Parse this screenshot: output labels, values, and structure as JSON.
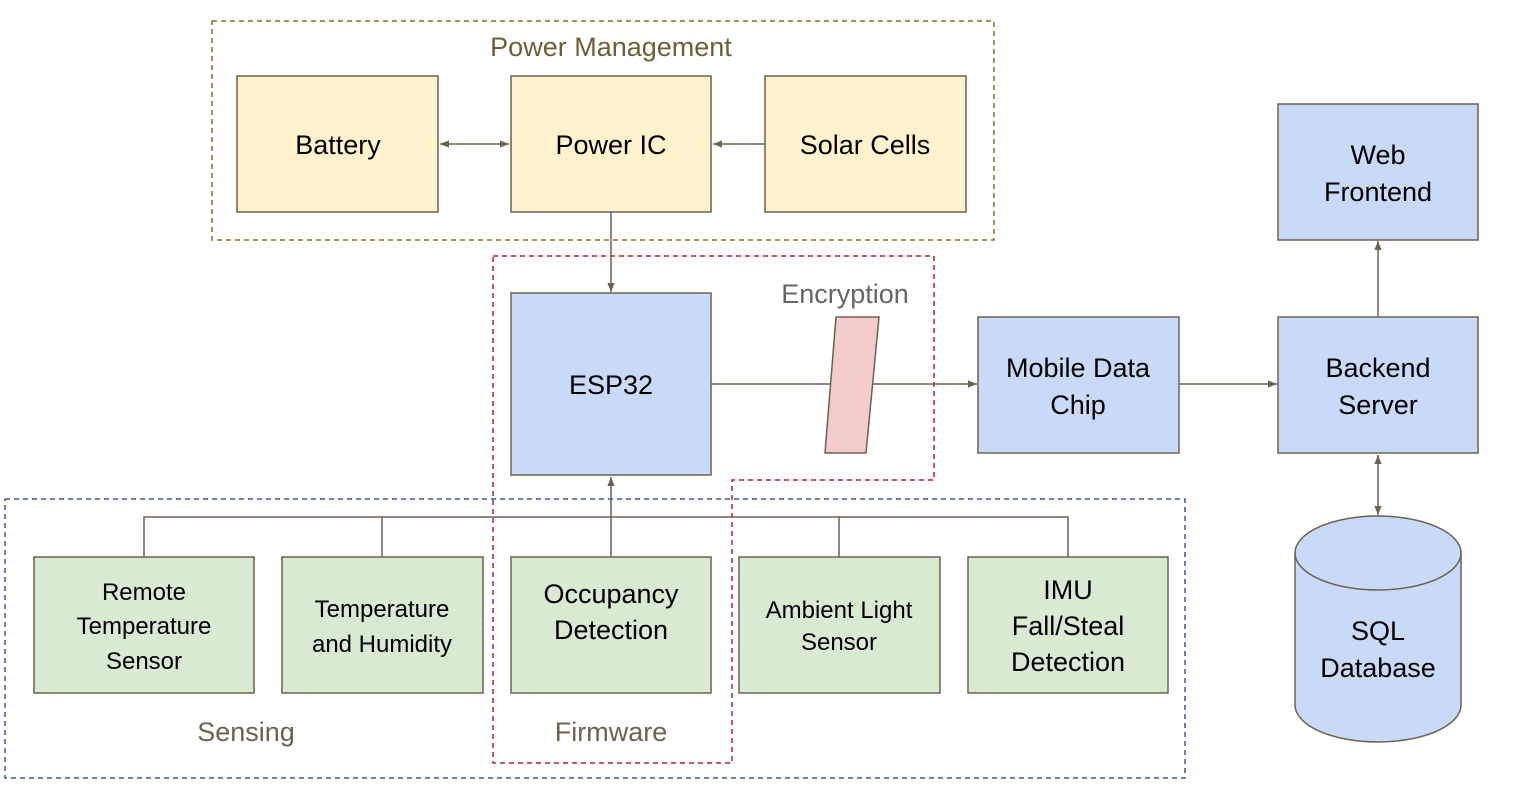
{
  "colors": {
    "power_fill": "#fff2cc",
    "compute_fill": "#c9daf8",
    "sensor_fill": "#d9ead3",
    "encryption_fill": "#f4cccc",
    "stroke": "#6b6250",
    "power_group_border": "#8a6d1c",
    "firmware_group_border": "#b3202a",
    "sensing_group_border": "#3d5a94"
  },
  "groups": {
    "power_management": "Power Management",
    "encryption": "Encryption",
    "sensing": "Sensing",
    "firmware": "Firmware"
  },
  "nodes": {
    "battery": [
      "Battery"
    ],
    "power_ic": [
      "Power IC"
    ],
    "solar_cells": [
      "Solar Cells"
    ],
    "esp32": [
      "ESP32"
    ],
    "mobile_data_chip": [
      "Mobile Data",
      "Chip"
    ],
    "backend_server": [
      "Backend",
      "Server"
    ],
    "web_frontend": [
      "Web",
      "Frontend"
    ],
    "sql_database": [
      "SQL",
      "Database"
    ],
    "remote_temperature_sensor": [
      "Remote",
      "Temperature",
      "Sensor"
    ],
    "temperature_humidity": [
      "Temperature",
      "and Humidity"
    ],
    "occupancy_detection": [
      "Occupancy",
      "Detection"
    ],
    "ambient_light_sensor": [
      "Ambient Light",
      "Sensor"
    ],
    "imu": [
      "IMU",
      "Fall/Steal",
      "Detection"
    ]
  }
}
